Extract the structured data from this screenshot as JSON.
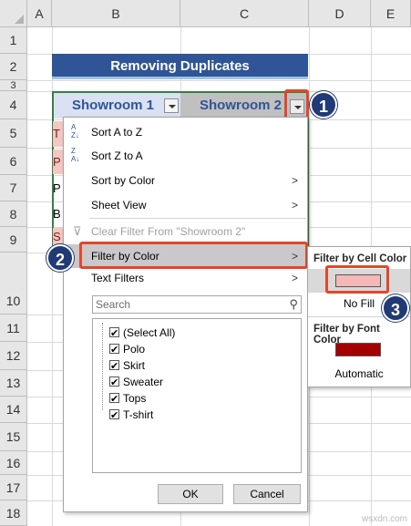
{
  "sheet": {
    "columns": [
      "A",
      "B",
      "C",
      "D",
      "E"
    ],
    "rows": [
      "1",
      "2",
      "3",
      "4",
      "5",
      "6",
      "7",
      "8",
      "9",
      "10",
      "11",
      "12",
      "13",
      "14",
      "15",
      "16",
      "17",
      "18"
    ],
    "title": "Removing Duplicates",
    "headers": [
      "Showroom 1",
      "Showroom 2"
    ],
    "partial_cells": [
      "T",
      "P",
      "P",
      "B",
      "S"
    ]
  },
  "menu": {
    "sort_az": "Sort A to Z",
    "sort_za": "Sort Z to A",
    "sort_by_color": "Sort by Color",
    "sheet_view": "Sheet View",
    "clear_filter": "Clear Filter From \"Showroom 2\"",
    "filter_by_color": "Filter by Color",
    "text_filters": "Text Filters",
    "search_placeholder": "Search",
    "items": [
      "(Select All)",
      "Polo",
      "Skirt",
      "Sweater",
      "Tops",
      "T-shirt"
    ],
    "ok": "OK",
    "cancel": "Cancel"
  },
  "submenu": {
    "cell_color_header": "Filter by Cell Color",
    "no_fill": "No Fill",
    "font_color_header": "Filter by Font Color",
    "automatic": "Automatic",
    "cell_color": "#f4b8b8",
    "font_color": "#a50000"
  },
  "callouts": [
    "1",
    "2",
    "3"
  ],
  "watermark": "wsxdn.com",
  "colors": {
    "title_bg": "#2f5597",
    "table_border": "#3a7d44",
    "callout_circle": "#1f3a74",
    "callout_outline": "#e2472b"
  }
}
